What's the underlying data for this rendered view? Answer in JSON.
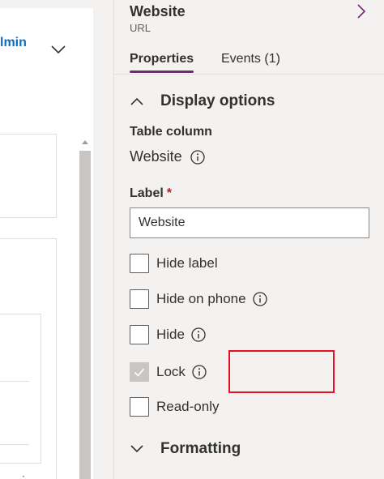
{
  "canvas": {
    "card_title": "lmin"
  },
  "panel": {
    "title": "Website",
    "subtitle": "URL",
    "tabs": [
      {
        "label": "Properties",
        "active": true
      },
      {
        "label": "Events (1)",
        "active": false
      }
    ],
    "display_section": {
      "title": "Display options",
      "table_column_label": "Table column",
      "table_column_value": "Website",
      "label_caption": "Label",
      "label_required": "*",
      "label_value": "Website",
      "options": [
        {
          "label": "Hide label",
          "checked": false,
          "info": false
        },
        {
          "label": "Hide on phone",
          "checked": false,
          "info": true
        },
        {
          "label": "Hide",
          "checked": false,
          "info": true
        },
        {
          "label": "Lock",
          "checked": true,
          "disabled": true,
          "info": true,
          "highlighted": true
        },
        {
          "label": "Read-only",
          "checked": false,
          "info": false
        }
      ]
    },
    "formatting_section": {
      "title": "Formatting"
    }
  },
  "colors": {
    "accent": "#742774",
    "link": "#0f6cbd",
    "highlight": "#e81123",
    "panel_bg": "#f3f2f1"
  }
}
